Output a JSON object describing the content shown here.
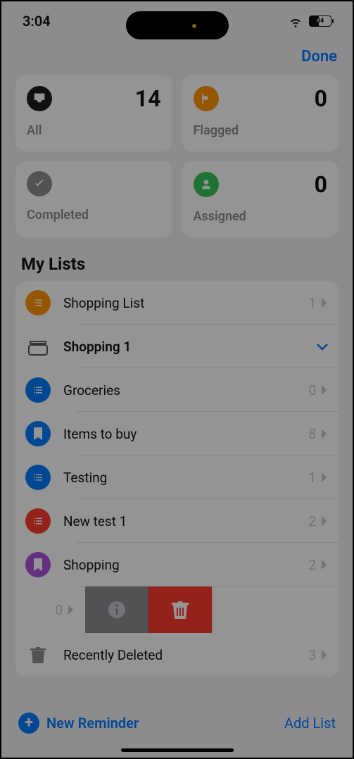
{
  "status_bar": {
    "time": "3:04",
    "battery_pct": "44"
  },
  "header": {
    "done": "Done"
  },
  "cards": {
    "all": {
      "label": "All",
      "count": "14",
      "color": "#1c1c1e"
    },
    "flagged": {
      "label": "Flagged",
      "count": "0",
      "color": "#ff9500"
    },
    "completed": {
      "label": "Completed",
      "count": "",
      "color": "#8e8e93"
    },
    "assigned": {
      "label": "Assigned",
      "count": "0",
      "color": "#34c759"
    }
  },
  "section_title": "My Lists",
  "lists": [
    {
      "name": "Shopping List",
      "count": "1",
      "color": "#ff9500",
      "icon": "list",
      "bold": false,
      "expandable": false
    },
    {
      "name": "Shopping 1",
      "count": "",
      "color": "#5b5b60",
      "icon": "folder",
      "bold": true,
      "expandable": true
    },
    {
      "name": "Groceries",
      "count": "0",
      "color": "#007aff",
      "icon": "list",
      "bold": false,
      "expandable": false
    },
    {
      "name": "Items to buy",
      "count": "8",
      "color": "#007aff",
      "icon": "bookmark",
      "bold": false,
      "expandable": false
    },
    {
      "name": "Testing",
      "count": "1",
      "color": "#007aff",
      "icon": "list",
      "bold": false,
      "expandable": false
    },
    {
      "name": "New test 1",
      "count": "2",
      "color": "#ff3b30",
      "icon": "list",
      "bold": false,
      "expandable": false
    },
    {
      "name": "Shopping",
      "count": "2",
      "color": "#af52de",
      "icon": "bookmark",
      "bold": false,
      "expandable": false
    }
  ],
  "swiped_row": {
    "count": "0"
  },
  "recently_deleted": {
    "name": "Recently Deleted",
    "count": "3"
  },
  "bottom": {
    "new_reminder": "New Reminder",
    "add_list": "Add List"
  }
}
